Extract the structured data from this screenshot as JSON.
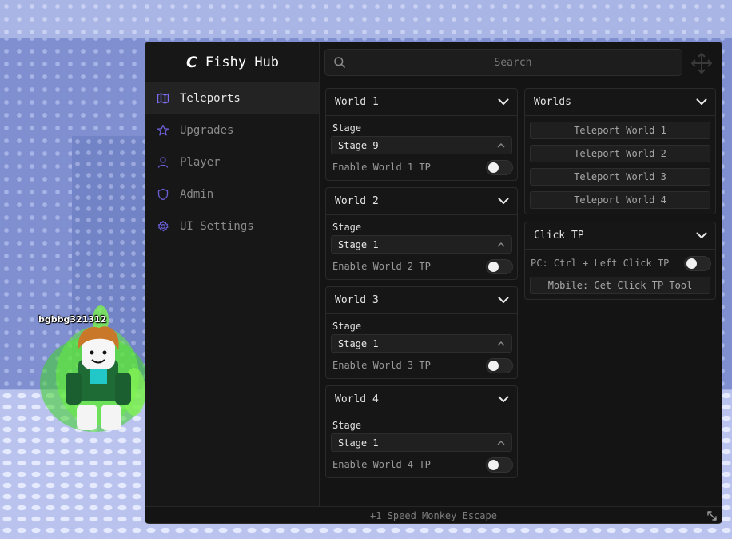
{
  "game": {
    "player_name": "bgbbg321312"
  },
  "app": {
    "logo": "C",
    "title": "Fishy Hub",
    "accent": "#7c6cf0"
  },
  "search": {
    "placeholder": "Search",
    "value": ""
  },
  "sidebar": {
    "items": [
      {
        "label": "Teleports",
        "icon": "map-icon",
        "active": true
      },
      {
        "label": "Upgrades",
        "icon": "star-icon",
        "active": false
      },
      {
        "label": "Player",
        "icon": "user-icon",
        "active": false
      },
      {
        "label": "Admin",
        "icon": "shield-icon",
        "active": false
      },
      {
        "label": "UI Settings",
        "icon": "gear-icon",
        "active": false
      }
    ]
  },
  "worlds": [
    {
      "title": "World 1",
      "stage_label": "Stage",
      "stage_value": "Stage 9",
      "toggle_label": "Enable World 1 TP",
      "enabled": false
    },
    {
      "title": "World 2",
      "stage_label": "Stage",
      "stage_value": "Stage 1",
      "toggle_label": "Enable World 2 TP",
      "enabled": false
    },
    {
      "title": "World 3",
      "stage_label": "Stage",
      "stage_value": "Stage 1",
      "toggle_label": "Enable World 3 TP",
      "enabled": false
    },
    {
      "title": "World 4",
      "stage_label": "Stage",
      "stage_value": "Stage 1",
      "toggle_label": "Enable World 4 TP",
      "enabled": false
    }
  ],
  "worlds_panel": {
    "title": "Worlds",
    "buttons": [
      "Teleport World 1",
      "Teleport World 2",
      "Teleport World 3",
      "Teleport World 4"
    ]
  },
  "click_tp": {
    "title": "Click TP",
    "toggle_label": "PC: Ctrl + Left Click TP",
    "enabled": false,
    "button": "Mobile: Get Click TP Tool"
  },
  "footer": {
    "text": "+1 Speed Monkey Escape"
  }
}
